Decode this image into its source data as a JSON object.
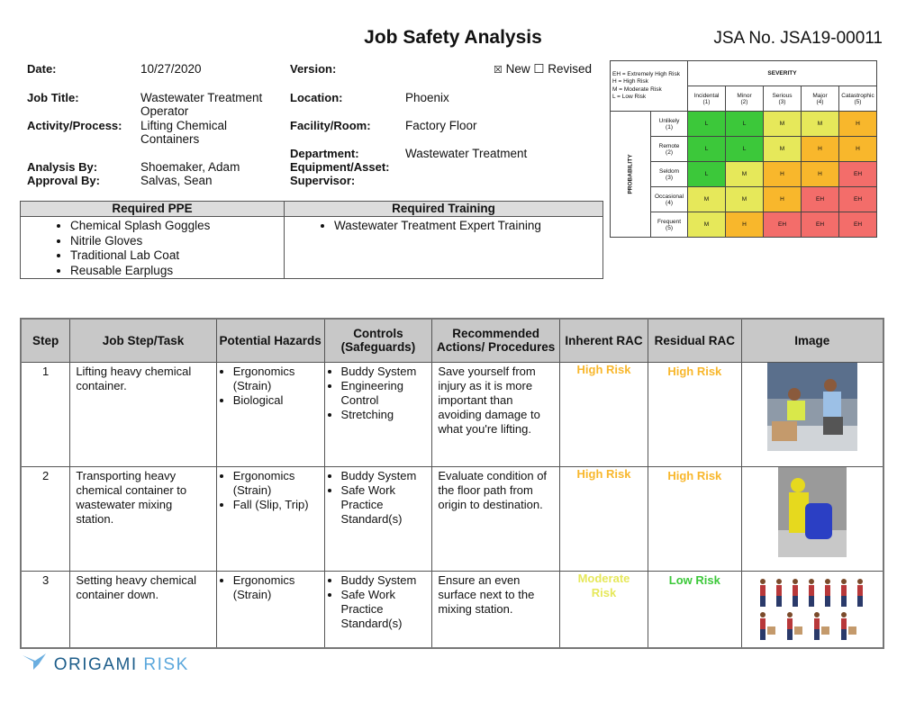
{
  "title": "Job Safety Analysis",
  "jsa_no": "JSA No. JSA19-00011",
  "info": {
    "date_label": "Date:",
    "date": "10/27/2020",
    "job_title_label": "Job Title:",
    "job_title": "Wastewater Treatment Operator",
    "activity_label": "Activity/Process:",
    "activity": "Lifting Chemical Containers",
    "analysis_label": "Analysis By:",
    "analysis": "Shoemaker, Adam",
    "approval_label": "Approval By:",
    "approval": "Salvas, Sean",
    "version_label": "Version:",
    "version_new": "New",
    "version_revised": "Revised",
    "version_new_checked": true,
    "location_label": "Location:",
    "location": "Phoenix",
    "facility_label": "Facility/Room:",
    "facility": "Factory Floor",
    "department_label": "Department:",
    "department": "Wastewater Treatment",
    "equipment_label": "Equipment/Asset:",
    "supervisor_label": "Supervisor:"
  },
  "ppe": {
    "header": "Required PPE",
    "items": [
      "Chemical Splash Goggles",
      "Nitrile Gloves",
      "Traditional Lab Coat",
      "Reusable Earplugs"
    ]
  },
  "training": {
    "header": "Required Training",
    "items": [
      "Wastewater Treatment Expert Training"
    ]
  },
  "matrix": {
    "legend": [
      "EH = Extremely High Risk",
      "H = High Risk",
      "M = Moderate Risk",
      "L = Low Risk"
    ],
    "severity_label": "SEVERITY",
    "probability_label": "PROBABILITY",
    "severity": [
      "Incidental",
      "Minor",
      "Serious",
      "Major",
      "Catastrophic"
    ],
    "severity_num": [
      "(1)",
      "(2)",
      "(3)",
      "(4)",
      "(5)"
    ],
    "probability": [
      "Unlikely",
      "Remote",
      "Seldom",
      "Occasional",
      "Frequent"
    ],
    "probability_num": [
      "(1)",
      "(2)",
      "(3)",
      "(4)",
      "(5)"
    ],
    "cells": [
      [
        "L",
        "L",
        "M",
        "M",
        "H"
      ],
      [
        "L",
        "L",
        "M",
        "H",
        "H"
      ],
      [
        "L",
        "M",
        "H",
        "H",
        "EH"
      ],
      [
        "M",
        "M",
        "H",
        "EH",
        "EH"
      ],
      [
        "M",
        "H",
        "EH",
        "EH",
        "EH"
      ]
    ],
    "colors": {
      "L": "#3cc83a",
      "M": "#e6e85a",
      "H": "#f8b72c",
      "EH": "#f36d6a"
    }
  },
  "steps": {
    "headers": [
      "Step",
      "Job Step/Task",
      "Potential Hazards",
      "Controls (Safeguards)",
      "Recommended Actions/ Procedures",
      "Inherent RAC",
      "Residual RAC",
      "Image"
    ],
    "rows": [
      {
        "step": "1",
        "task": "Lifting heavy chemical container.",
        "hazards": [
          "Ergonomics (Strain)",
          "Biological"
        ],
        "controls": [
          "Buddy System",
          "Engineering Control",
          "Stretching"
        ],
        "actions": "Save yourself from injury as it is more important than avoiding damage to what you're lifting.",
        "inherent": "High Risk",
        "inherent_color": "#f8b72c",
        "residual": "High Risk",
        "residual_color": "#f8b72c",
        "image": "two-workers-lifting-box"
      },
      {
        "step": "2",
        "task": "Transporting heavy chemical container to wastewater mixing station.",
        "hazards": [
          "Ergonomics (Strain)",
          "Fall (Slip, Trip)"
        ],
        "controls": [
          "Buddy System",
          "Safe Work Practice Standard(s)"
        ],
        "actions": "Evaluate condition of the floor path from origin to destination.",
        "inherent": "High Risk",
        "inherent_color": "#f8b72c",
        "residual": "High Risk",
        "residual_color": "#f8b72c",
        "image": "hazmat-worker-with-drum"
      },
      {
        "step": "3",
        "task": "Setting heavy chemical container down.",
        "hazards": [
          "Ergonomics (Strain)"
        ],
        "controls": [
          "Buddy System",
          "Safe Work Practice Standard(s)"
        ],
        "actions": "Ensure an even surface next to the mixing station.",
        "inherent": "Moderate Risk",
        "inherent_color": "#e6e85a",
        "residual": "Low Risk",
        "residual_color": "#3cc83a",
        "image": "lifting-technique-figures"
      }
    ]
  },
  "logo": {
    "text1": "ORIGAMI",
    "text2": "RISK"
  }
}
